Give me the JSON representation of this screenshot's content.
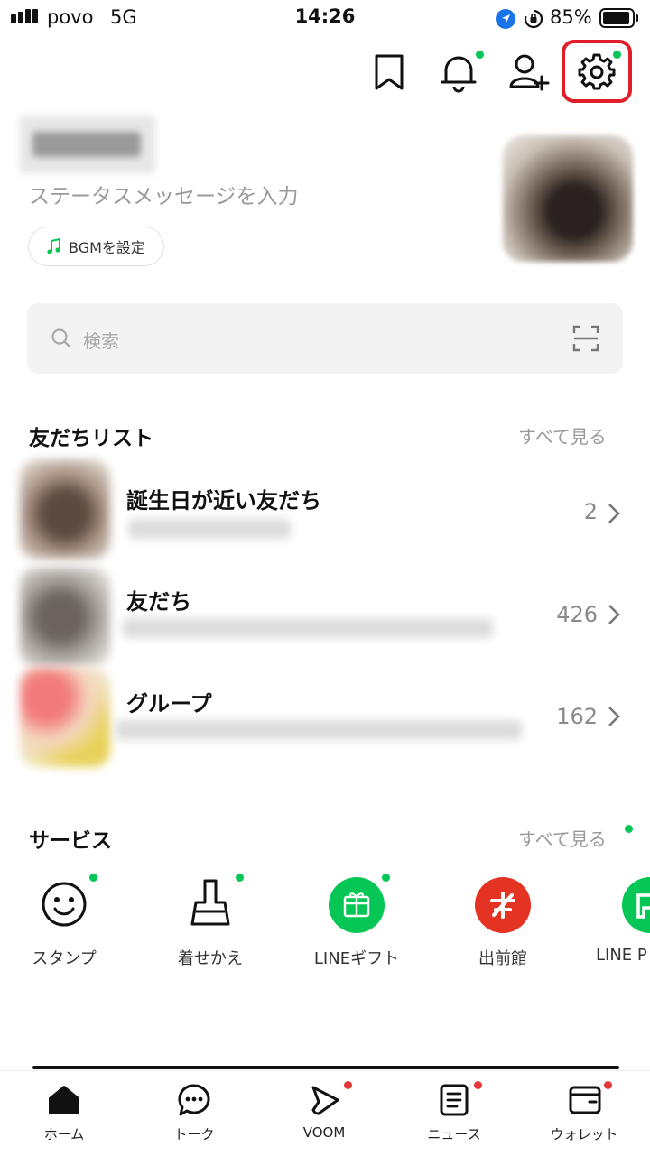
{
  "status_bar": {
    "carrier": "povo",
    "network": "5G",
    "time": "14:26",
    "battery": "85%"
  },
  "profile": {
    "status_message_placeholder": "ステータスメッセージを入力",
    "bgm_label": "BGMを設定"
  },
  "search": {
    "placeholder": "検索"
  },
  "friends_section": {
    "title": "友だちリスト",
    "see_all": "すべて見る",
    "rows": [
      {
        "title": "誕生日が近い友だち",
        "count": "2"
      },
      {
        "title": "友だち",
        "count": "426"
      },
      {
        "title": "グループ",
        "count": "162"
      }
    ]
  },
  "services_section": {
    "title": "サービス",
    "see_all": "すべて見る",
    "items": [
      {
        "label": "スタンプ",
        "icon": "smiley-icon"
      },
      {
        "label": "着せかえ",
        "icon": "brush-icon"
      },
      {
        "label": "LINEギフト",
        "icon": "gift-icon"
      },
      {
        "label": "出前館",
        "icon": "demaekan-icon"
      },
      {
        "label": "LINE P",
        "icon": "line-pay-icon"
      }
    ]
  },
  "bottom_nav": [
    {
      "label": "ホーム",
      "icon": "home-icon"
    },
    {
      "label": "トーク",
      "icon": "chat-icon"
    },
    {
      "label": "VOOM",
      "icon": "voom-icon"
    },
    {
      "label": "ニュース",
      "icon": "news-icon"
    },
    {
      "label": "ウォレット",
      "icon": "wallet-icon"
    }
  ],
  "colors": {
    "accent_green": "#06c755",
    "notice_red": "#e53935",
    "highlight_red": "#e11d2a"
  }
}
